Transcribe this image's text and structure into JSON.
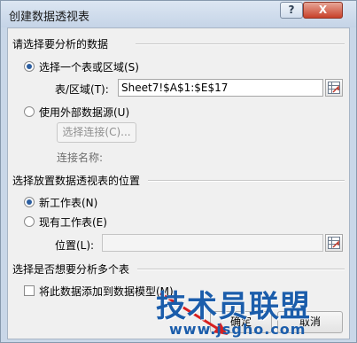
{
  "window": {
    "title": "创建数据透视表",
    "help_glyph": "?",
    "close_glyph": "X"
  },
  "source": {
    "section_title": "请选择要分析的数据",
    "option_range": "选择一个表或区域(S)",
    "range_label": "表/区域(T):",
    "range_value": "Sheet7!$A$1:$E$17",
    "option_external": "使用外部数据源(U)",
    "choose_connection_button": "选择连接(C)...",
    "connection_name_label": "连接名称:"
  },
  "placement": {
    "section_title": "选择放置数据透视表的位置",
    "option_new_sheet": "新工作表(N)",
    "option_existing_sheet": "现有工作表(E)",
    "location_label": "位置(L):",
    "location_value": ""
  },
  "multiple": {
    "section_title": "选择是否想要分析多个表",
    "add_to_model_label": "将此数据添加到数据模型(M)"
  },
  "buttons": {
    "ok_label": "确定",
    "cancel_label": "取消"
  },
  "watermark": {
    "text": "技术员联盟",
    "url": "www.jsgho.com"
  },
  "colors": {
    "accent": "#2c5ea0",
    "close": "#c8412a",
    "watermark": "#1b5dab",
    "arrow": "#d81f1f"
  },
  "state": {
    "selected_source": "range",
    "selected_placement": "new_sheet",
    "add_to_model": false
  }
}
